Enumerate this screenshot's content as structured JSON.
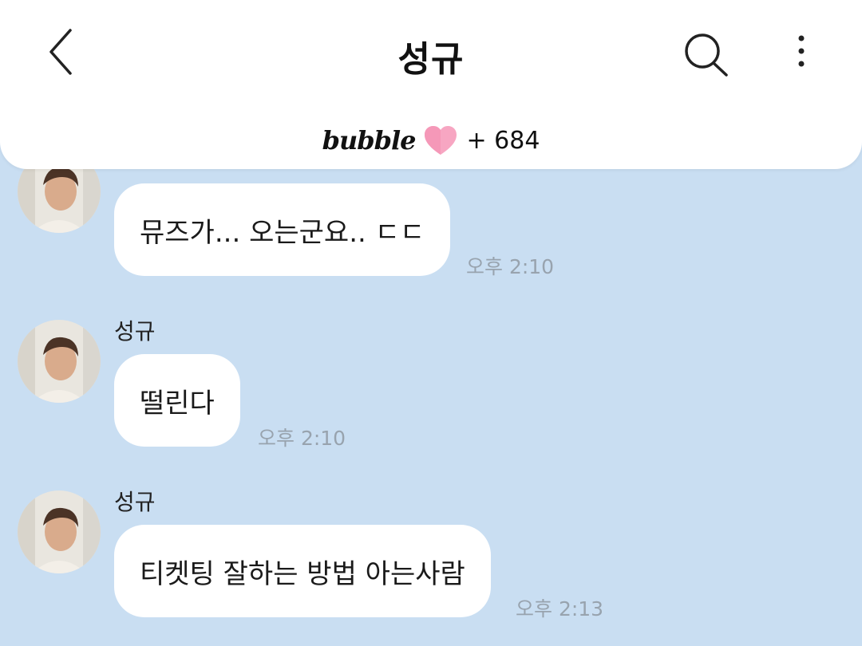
{
  "header": {
    "title": "성규",
    "brand": "bubble",
    "heart_count": "+ 684"
  },
  "messages": [
    {
      "sender": "",
      "text": "뮤즈가... 오는군요.. ㄷㄷ",
      "time": "오후 2:10"
    },
    {
      "sender": "성규",
      "text": "떨린다",
      "time": "오후 2:10"
    },
    {
      "sender": "성규",
      "text": "티켓팅 잘하는 방법 아는사람",
      "time": "오후 2:13"
    }
  ],
  "icons": {
    "back": "chevron-left-icon",
    "search": "search-icon",
    "more": "more-vertical-icon",
    "heart": "heart-icon"
  },
  "colors": {
    "background": "#c9def2",
    "bubble": "#ffffff",
    "header": "#ffffff",
    "heart": "#f48fb1",
    "timestamp": "#98a3ae"
  }
}
